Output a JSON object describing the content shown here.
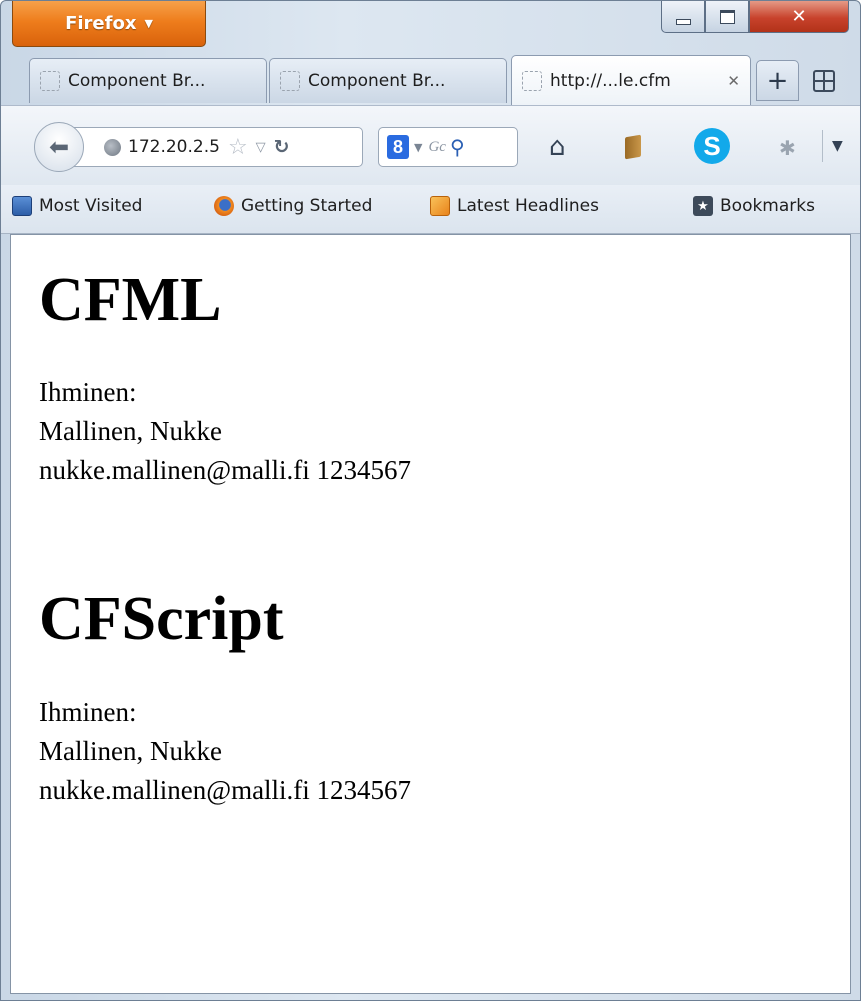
{
  "browser": {
    "menu_button": "Firefox",
    "tabs": [
      {
        "title": "Component Br...",
        "active": false
      },
      {
        "title": "Component Br...",
        "active": false
      },
      {
        "title": "http://...le.cfm",
        "active": true
      }
    ],
    "address": "172.20.2.5",
    "search_placeholder": "Gc",
    "search_engine_badge": "8",
    "bookmarks": [
      {
        "label": "Most Visited",
        "icon": "most-visited-icon"
      },
      {
        "label": "Getting Started",
        "icon": "firefox-icon"
      },
      {
        "label": "Latest Headlines",
        "icon": "rss-icon"
      },
      {
        "label": "Bookmarks",
        "icon": "bookmarks-icon"
      }
    ],
    "accent": "#ee7d1c"
  },
  "page": {
    "sections": [
      {
        "heading": "CFML",
        "lines": [
          "Ihminen:",
          "Mallinen, Nukke",
          "nukke.mallinen@malli.fi 1234567"
        ]
      },
      {
        "heading": "CFScript",
        "lines": [
          "Ihminen:",
          "Mallinen, Nukke",
          "nukke.mallinen@malli.fi 1234567"
        ]
      }
    ]
  }
}
